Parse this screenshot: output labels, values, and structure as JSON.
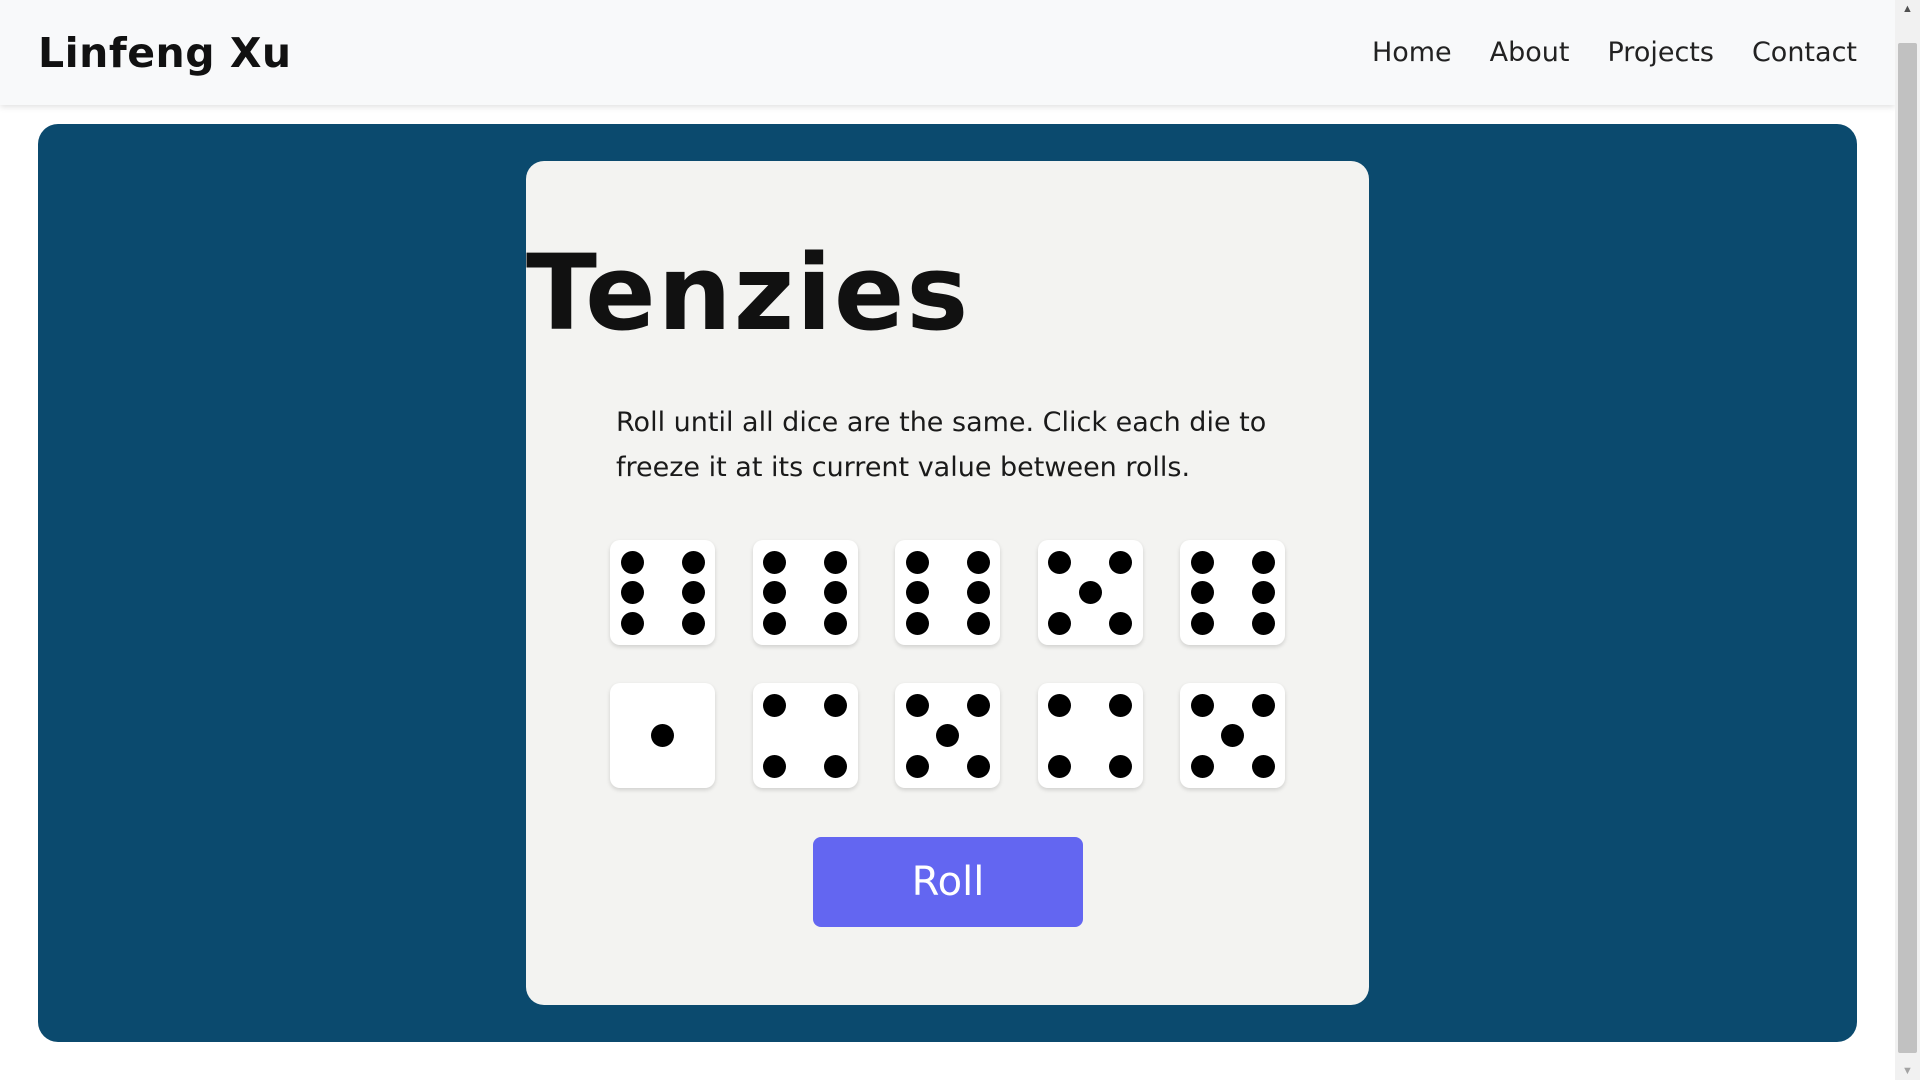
{
  "navbar": {
    "brand": "Linfeng Xu",
    "links": [
      "Home",
      "About",
      "Projects",
      "Contact"
    ]
  },
  "game": {
    "title": "Tenzies",
    "instructions": "Roll until all dice are the same. Click each die to freeze it at its current value between rolls.",
    "dice": [
      6,
      6,
      6,
      5,
      6,
      1,
      4,
      5,
      4,
      5
    ],
    "roll_label": "Roll"
  },
  "colors": {
    "stage_background": "#0b4a6e",
    "card_background": "#f3f3f1",
    "roll_button": "#6366f1",
    "navbar_background": "#f8f9fa"
  },
  "icons": {
    "scroll_up": "scroll-up-arrow-icon",
    "scroll_down": "scroll-down-arrow-icon",
    "die_pip": "die-pip-icon"
  }
}
